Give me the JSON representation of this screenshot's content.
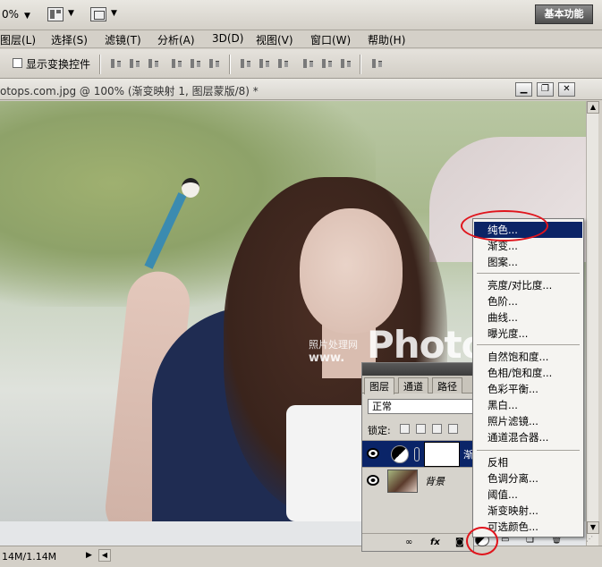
{
  "appbar": {
    "zoom": "0%",
    "workspace_button": "基本功能"
  },
  "menubar": {
    "items": [
      "图层(L)",
      "选择(S)",
      "滤镜(T)",
      "分析(A)",
      "3D(D)",
      "视图(V)",
      "窗口(W)",
      "帮助(H)"
    ]
  },
  "options": {
    "show_transform_controls": "显示变换控件"
  },
  "document": {
    "title": "otops.com.jpg @ 100% (渐变映射 1, 图层蒙版/8) *"
  },
  "watermark": {
    "small": "照片处理网",
    "url": "www.",
    "big": "PhotoPS"
  },
  "status": {
    "text": "14M/1.14M"
  },
  "layers_panel": {
    "tabs": [
      "图层",
      "通道",
      "路径"
    ],
    "blend_mode": "正常",
    "lock_label": "锁定:",
    "layers": [
      {
        "name": "渐",
        "selected": true,
        "type": "adjustment"
      },
      {
        "name": "背景",
        "selected": false,
        "type": "image"
      }
    ],
    "footer_icons": [
      "link-icon",
      "fx-icon",
      "mask-icon",
      "adjustment-icon",
      "folder-icon",
      "new-layer-icon",
      "trash-icon"
    ]
  },
  "adjustment_menu": {
    "groups": [
      [
        "纯色...",
        "渐变...",
        "图案..."
      ],
      [
        "亮度/对比度...",
        "色阶...",
        "曲线...",
        "曝光度..."
      ],
      [
        "自然饱和度...",
        "色相/饱和度...",
        "色彩平衡...",
        "黑白...",
        "照片滤镜...",
        "通道混合器..."
      ],
      [
        "反相",
        "色调分离...",
        "阈值...",
        "渐变映射...",
        "可选颜色..."
      ]
    ],
    "highlighted": "纯色..."
  },
  "colors": {
    "menu_highlight": "#0c2466",
    "annotation_red": "#e0141c",
    "selected_layer": "#0a2468"
  }
}
